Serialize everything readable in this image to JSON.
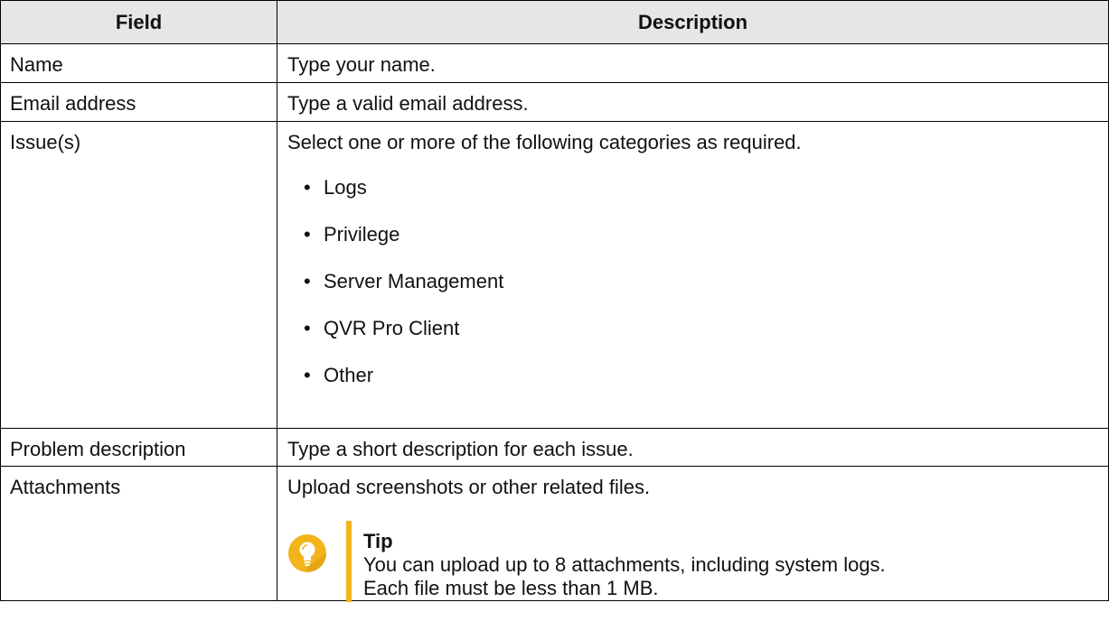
{
  "table": {
    "headers": [
      "Field",
      "Description"
    ],
    "rows": {
      "name": {
        "field": "Name",
        "description": "Type your name."
      },
      "email": {
        "field": "Email address",
        "description": "Type a valid email address."
      },
      "issues": {
        "field": "Issue(s)",
        "description": "Select one or more of the following categories as required.",
        "options": [
          "Logs",
          "Privilege",
          "Server Management",
          "QVR Pro Client",
          "Other"
        ]
      },
      "problem": {
        "field": "Problem description",
        "description": "Type a short description for each issue."
      },
      "attachments": {
        "field": "Attachments",
        "description": "Upload screenshots or other related files.",
        "tip": {
          "icon": "lightbulb-icon",
          "title": "Tip",
          "line1": "You can upload up to 8 attachments, including system logs.",
          "line2": "Each file must be less than 1 MB."
        }
      }
    }
  },
  "colors": {
    "header_bg": "#e6e6e6",
    "tip_accent": "#f3b41b"
  }
}
